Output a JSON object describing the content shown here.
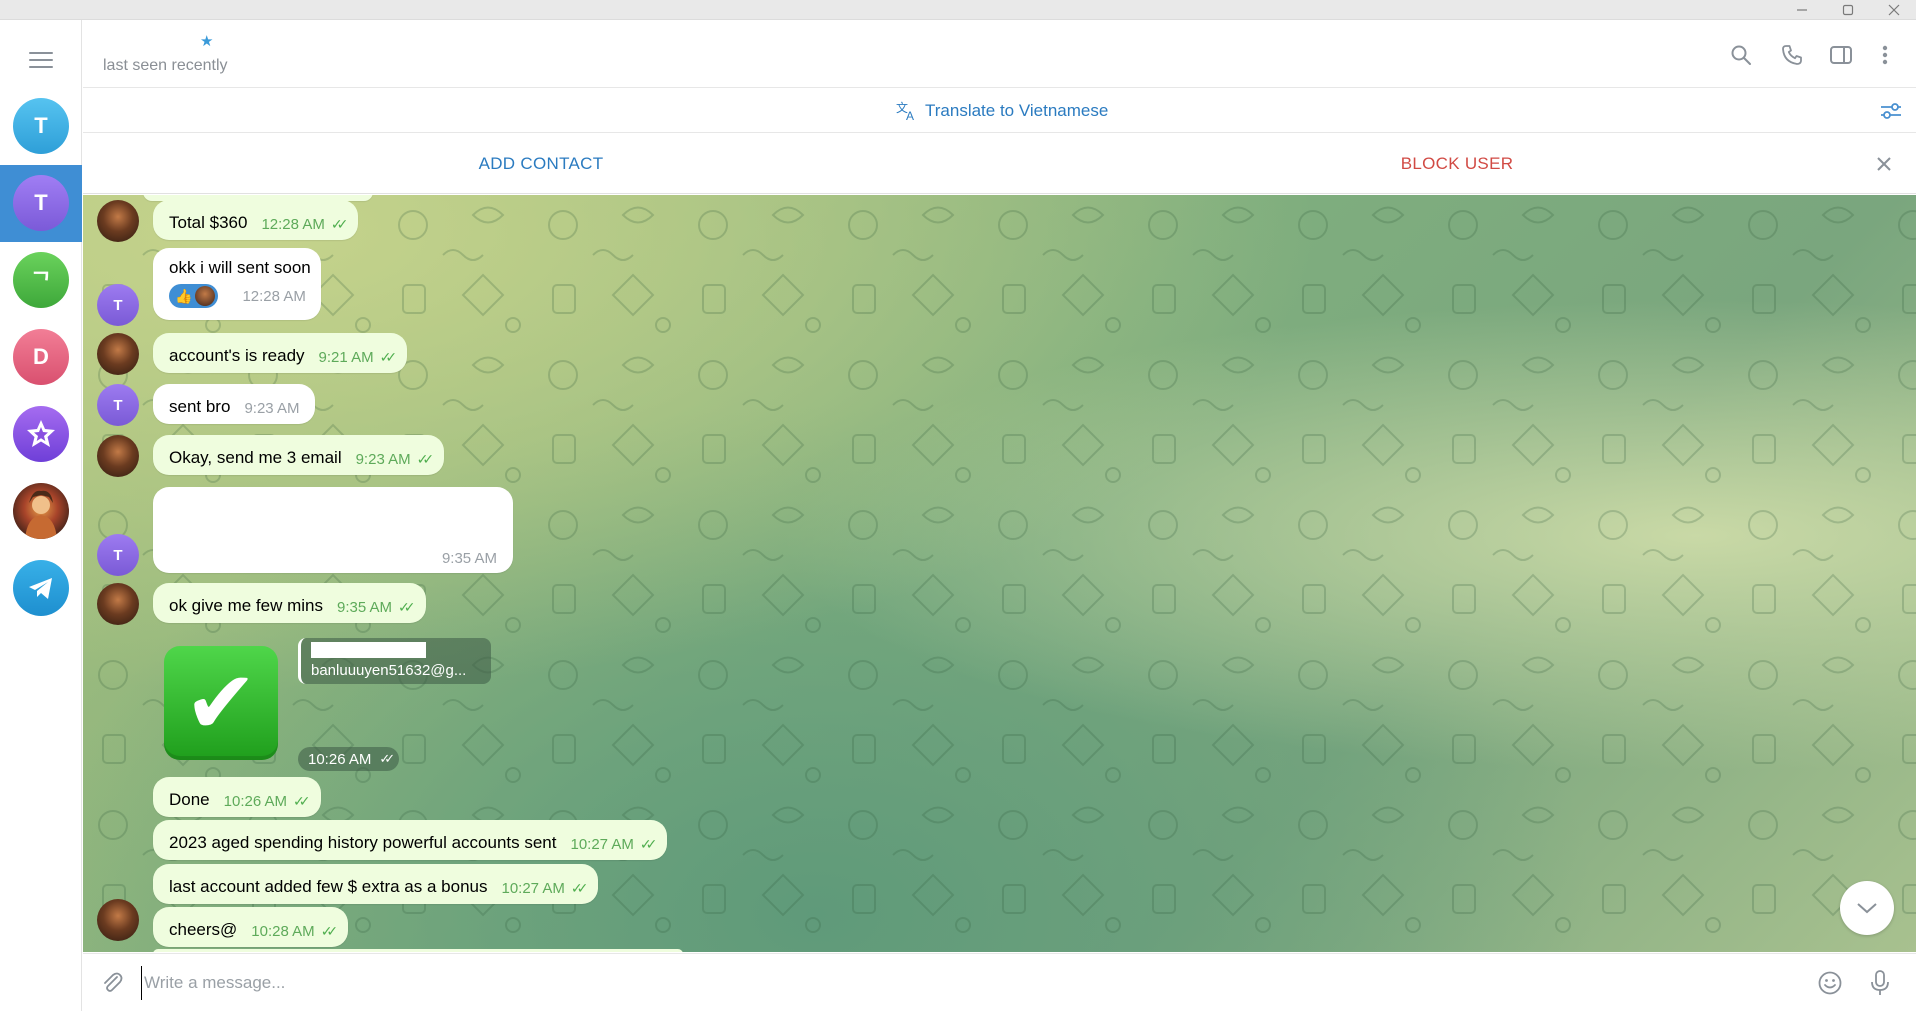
{
  "window": {
    "minimize_icon": "minimize-icon",
    "maximize_icon": "maximize-icon",
    "close_icon": "close-icon"
  },
  "sidebar": {
    "chats": [
      {
        "letter": "T",
        "color": "#3aaee0"
      },
      {
        "letter": "T",
        "color": "#8a67e8",
        "active": true
      },
      {
        "letter": "ᄀ",
        "color": "#4fbb49"
      },
      {
        "letter": "D",
        "color": "#e35d7d"
      },
      {
        "letter": "",
        "color": "#8a4fe0",
        "icon": "star-badge-icon"
      },
      {
        "letter": "",
        "icon": "profile-photo"
      },
      {
        "letter": "",
        "color": "#2d9fdb",
        "icon": "telegram-icon"
      }
    ]
  },
  "header": {
    "status": "last seen recently",
    "star": "★",
    "icons": [
      "search-icon",
      "phone-icon",
      "sidebar-toggle-icon",
      "more-vertical-icon"
    ]
  },
  "translate": {
    "label": "Translate to Vietnamese"
  },
  "action_bar": {
    "add_contact": "ADD CONTACT",
    "block_user": "BLOCK USER"
  },
  "messages": [
    {
      "text": "Total $360",
      "time": "12:28 AM",
      "out": true,
      "read": true
    },
    {
      "text": "okk i will sent soon",
      "time": "12:28 AM",
      "out": false,
      "reactions": [
        "👍"
      ]
    },
    {
      "text": "account's is ready",
      "time": "9:21 AM",
      "out": true,
      "read": true
    },
    {
      "text": "sent bro",
      "time": "9:23 AM",
      "out": false
    },
    {
      "text": "Okay, send me 3 email",
      "time": "9:23 AM",
      "out": true,
      "read": true
    },
    {
      "text": "",
      "time": "9:35 AM",
      "out": false
    },
    {
      "text": "ok give me few mins",
      "time": "9:35 AM",
      "out": true,
      "read": true
    },
    {
      "text": "banluuuyen51632@g...",
      "time": "10:26 AM",
      "out": true,
      "read": true,
      "emoji": "✔"
    },
    {
      "text": "Done",
      "time": "10:26 AM",
      "out": true,
      "read": true
    },
    {
      "text": "2023 aged spending history powerful accounts sent",
      "time": "10:27 AM",
      "out": true,
      "read": true
    },
    {
      "text": "last account added few $ extra as a bonus",
      "time": "10:27 AM",
      "out": true,
      "read": true
    },
    {
      "text": "cheers@",
      "time": "10:28 AM",
      "out": true,
      "read": true
    }
  ],
  "composer": {
    "placeholder": "Write a message..."
  },
  "ticks": "✓✓",
  "colors": {
    "accent": "#2b7bc0",
    "danger": "#d14a44",
    "out_bubble": "#effdde",
    "in_bubble": "#ffffff"
  }
}
